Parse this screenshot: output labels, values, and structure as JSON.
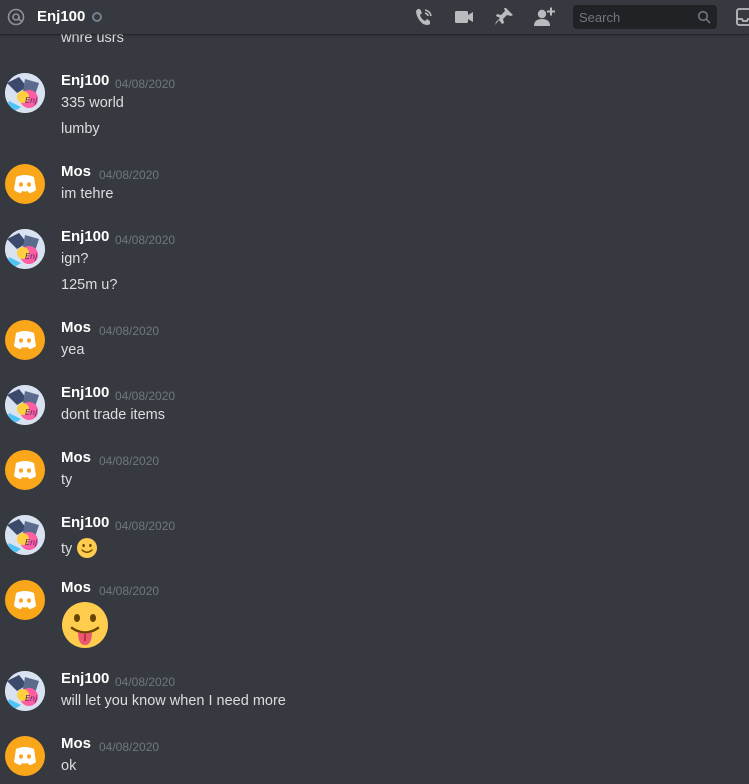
{
  "header": {
    "channel_name": "Enj100",
    "search_placeholder": "Search",
    "icons": [
      "at-icon",
      "phone-call-icon",
      "video-call-icon",
      "pin-icon",
      "add-friend-icon",
      "search-icon",
      "inbox-icon"
    ]
  },
  "cut_off_message": "whre usrs",
  "messages": [
    {
      "author": "Enj100",
      "time": "04/08/2020",
      "avatar": "enj-avatar",
      "lines": [
        "335 world",
        "lumby"
      ]
    },
    {
      "author": "Mos",
      "time": "04/08/2020",
      "avatar": "discord-default-avatar",
      "lines": [
        "im tehre"
      ]
    },
    {
      "author": "Enj100",
      "time": "04/08/2020",
      "avatar": "enj-avatar",
      "lines": [
        "ign?",
        "125m u?"
      ]
    },
    {
      "author": "Mos",
      "time": "04/08/2020",
      "avatar": "discord-default-avatar",
      "lines": [
        "yea"
      ]
    },
    {
      "author": "Enj100",
      "time": "04/08/2020",
      "avatar": "enj-avatar",
      "lines": [
        "dont trade items"
      ]
    },
    {
      "author": "Mos",
      "time": "04/08/2020",
      "avatar": "discord-default-avatar",
      "lines": [
        "ty"
      ]
    },
    {
      "author": "Enj100",
      "time": "04/08/2020",
      "avatar": "enj-avatar",
      "lines": [
        "ty"
      ],
      "emoji": "slightly-smiling-face-emoji"
    },
    {
      "author": "Mos",
      "time": "04/08/2020",
      "avatar": "discord-default-avatar",
      "lines": [],
      "emoji": "tongue-out-face-emoji"
    },
    {
      "author": "Enj100",
      "time": "04/08/2020",
      "avatar": "enj-avatar",
      "lines": [
        "will let you know when I need more"
      ]
    },
    {
      "author": "Mos",
      "time": "04/08/2020",
      "avatar": "discord-default-avatar",
      "lines": [
        "ok"
      ]
    }
  ],
  "colors": {
    "background": "#36393f",
    "text": "#dcddde",
    "username": "#ffffff",
    "timestamp": "#72767d",
    "discord_avatar": "#faa61a",
    "search_bg": "#202225"
  }
}
